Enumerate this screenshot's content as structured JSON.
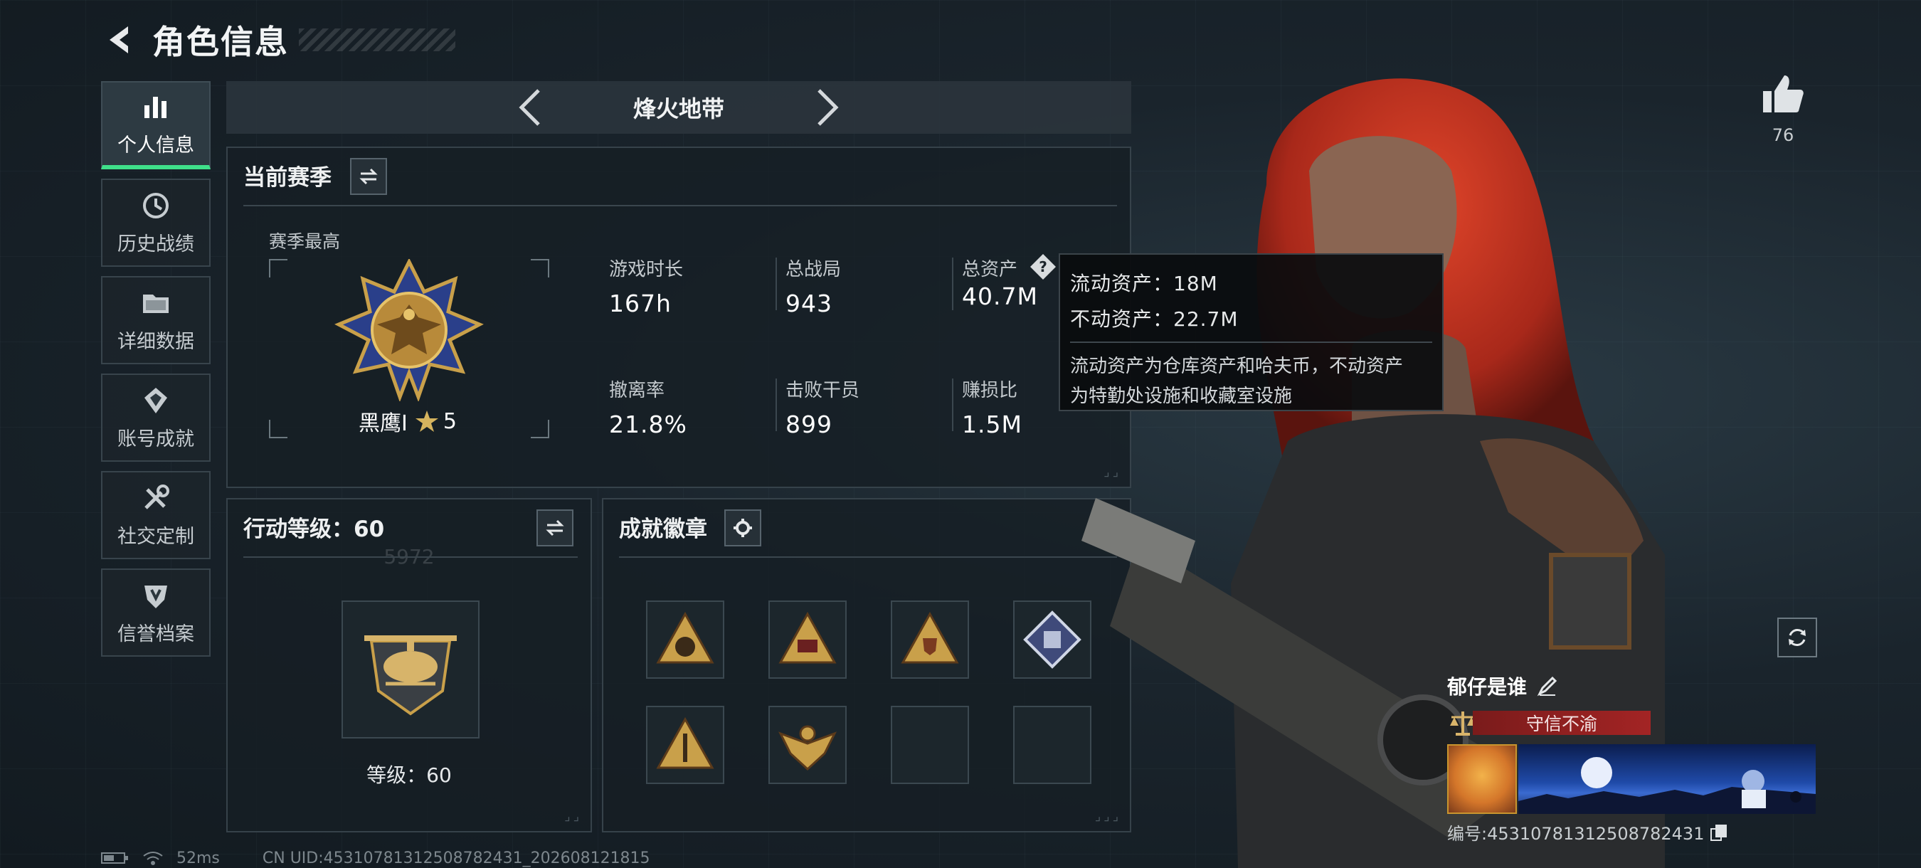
{
  "header": {
    "title": "角色信息"
  },
  "sidebar": {
    "items": [
      {
        "label": "个人信息",
        "icon": "bar-chart-icon",
        "active": true
      },
      {
        "label": "历史战绩",
        "icon": "history-icon"
      },
      {
        "label": "详细数据",
        "icon": "folder-icon"
      },
      {
        "label": "账号成就",
        "icon": "achievement-icon"
      },
      {
        "label": "社交定制",
        "icon": "tools-icon"
      },
      {
        "label": "信誉档案",
        "icon": "credit-shield-icon"
      }
    ]
  },
  "mode": {
    "name": "烽火地带"
  },
  "season": {
    "title": "当前赛季",
    "best_label": "赛季最高",
    "rank_name": "黑鹰I",
    "rank_stars": "5",
    "rank_score": "5972",
    "stats": [
      {
        "label": "游戏时长",
        "value": "167h"
      },
      {
        "label": "总战局",
        "value": "943"
      },
      {
        "label": "总资产",
        "value": "40.7M"
      },
      {
        "label": "撤离率",
        "value": "21.8%"
      },
      {
        "label": "击败干员",
        "value": "899"
      },
      {
        "label": "赚损比",
        "value": "1.5M"
      }
    ]
  },
  "tooltip": {
    "liquid": "流动资产：18M",
    "fixed": "不动资产：22.7M",
    "desc_line1": "流动资产为仓库资产和哈夫币，不动资产",
    "desc_line2": "为特勤处设施和收藏室设施"
  },
  "level": {
    "title": "行动等级：60",
    "caption": "等级：60"
  },
  "achievements": {
    "title": "成就徽章",
    "badges": [
      "badge-1",
      "badge-2",
      "badge-3",
      "badge-4",
      "badge-5",
      "badge-6",
      "",
      ""
    ]
  },
  "likes": {
    "count": "76"
  },
  "player": {
    "name": "郁仔是谁",
    "title": "守信不渝",
    "id": "编号:45310781312508782431"
  },
  "status": {
    "ping": "52ms",
    "uid": "CN UID:45310781312508782431_202608121815"
  },
  "colors": {
    "accent": "#3fe08a",
    "title_red": "#a32424",
    "gold": "#c9a04a"
  }
}
